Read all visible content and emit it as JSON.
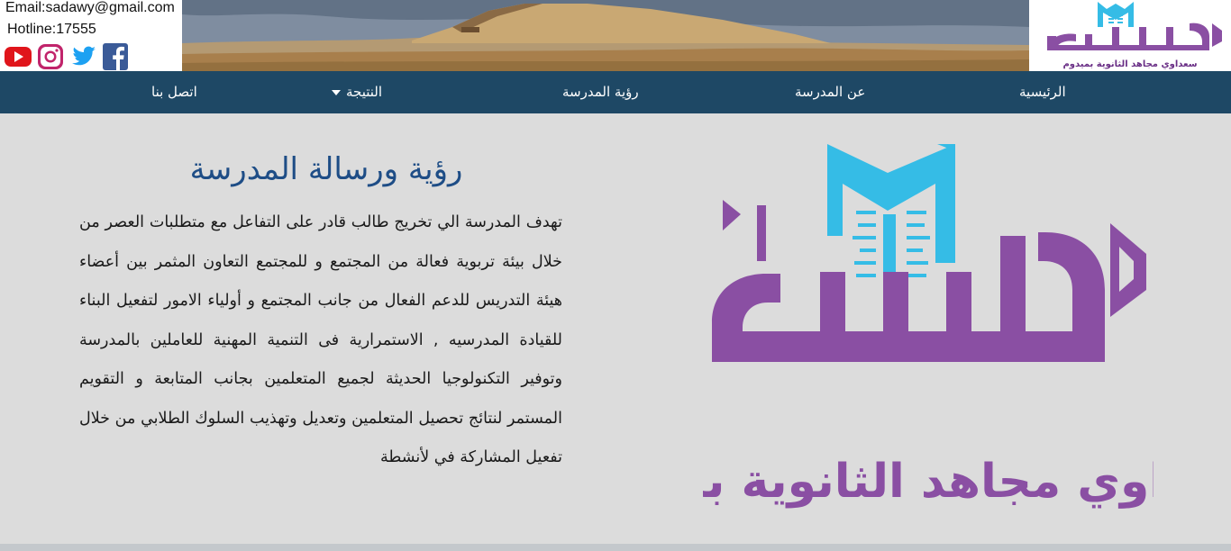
{
  "contact": {
    "email": "Email:sadawy@gmail.com",
    "hotline": "Hotline:17555"
  },
  "social": [
    "youtube-icon",
    "instagram-icon",
    "twitter-icon",
    "facebook-icon"
  ],
  "nav": {
    "home": "الرئيسية",
    "about": "عن المدرسة",
    "vision": "رؤية المدرسة",
    "result": "النتيجة",
    "contact": "اتصل بنا"
  },
  "main": {
    "heading": "رؤية ورسالة المدرسة",
    "paragraph": "تهدف المدرسة الي تخريج طالب قادر على التفاعل مع متطلبات العصر من خلال بيئة تربوية فعالة من المجتمع و للمجتمع التعاون المثمر بين أعضاء هيئة التدريس للدعم الفعال من جانب المجتمع و أولياء الامور لتفعيل البناء للقيادة المدرسيه , الاستمرارية فى التنمية المهنية للعاملين بالمدرسة وتوفير التكنولوجيا الحديثة لجميع المتعلمين بجانب المتابعة و التقويم المستمر لنتائج تحصيل المتعلمين وتعديل وتهذيب السلوك الطلابي من خلال تفعيل المشاركة في لأنشطة"
  },
  "logo": {
    "word": "مدرسة",
    "subtitle": "سعداوي مجاهد الثانوية بميدوم"
  },
  "colors": {
    "nav": "#1e4865",
    "heading": "#1e4d86",
    "logo_purple": "#8a4fa3",
    "logo_blue": "#35bce6",
    "background": "#dcdcdc"
  }
}
